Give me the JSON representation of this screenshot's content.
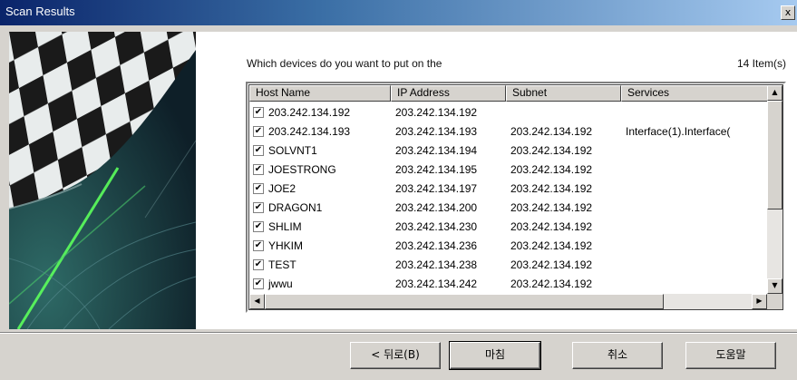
{
  "window": {
    "title": "Scan Results",
    "close_glyph": "x"
  },
  "prompt": "Which devices do you want to put on the",
  "item_count": "14 Item(s)",
  "columns": [
    "Host Name",
    "IP Address",
    "Subnet",
    "Services"
  ],
  "rows": [
    {
      "checked": true,
      "host": "203.242.134.192",
      "ip": "203.242.134.192",
      "subnet": "",
      "services": ""
    },
    {
      "checked": true,
      "host": "203.242.134.193",
      "ip": "203.242.134.193",
      "subnet": "203.242.134.192",
      "services": "Interface(1).Interface("
    },
    {
      "checked": true,
      "host": "SOLVNT1",
      "ip": "203.242.134.194",
      "subnet": "203.242.134.192",
      "services": ""
    },
    {
      "checked": true,
      "host": "JOESTRONG",
      "ip": "203.242.134.195",
      "subnet": "203.242.134.192",
      "services": ""
    },
    {
      "checked": true,
      "host": "JOE2",
      "ip": "203.242.134.197",
      "subnet": "203.242.134.192",
      "services": ""
    },
    {
      "checked": true,
      "host": "DRAGON1",
      "ip": "203.242.134.200",
      "subnet": "203.242.134.192",
      "services": ""
    },
    {
      "checked": true,
      "host": "SHLIM",
      "ip": "203.242.134.230",
      "subnet": "203.242.134.192",
      "services": ""
    },
    {
      "checked": true,
      "host": "YHKIM",
      "ip": "203.242.134.236",
      "subnet": "203.242.134.192",
      "services": ""
    },
    {
      "checked": true,
      "host": "TEST",
      "ip": "203.242.134.238",
      "subnet": "203.242.134.192",
      "services": ""
    },
    {
      "checked": true,
      "host": "jwwu",
      "ip": "203.242.134.242",
      "subnet": "203.242.134.192",
      "services": ""
    }
  ],
  "icons": {
    "check": "✔",
    "scroll_up": "▲",
    "scroll_down": "▼",
    "scroll_left": "◀",
    "scroll_right": "▶"
  },
  "buttons": {
    "back": "< 뒤로(B)",
    "finish": "마침",
    "cancel": "취소",
    "help": "도움말"
  }
}
